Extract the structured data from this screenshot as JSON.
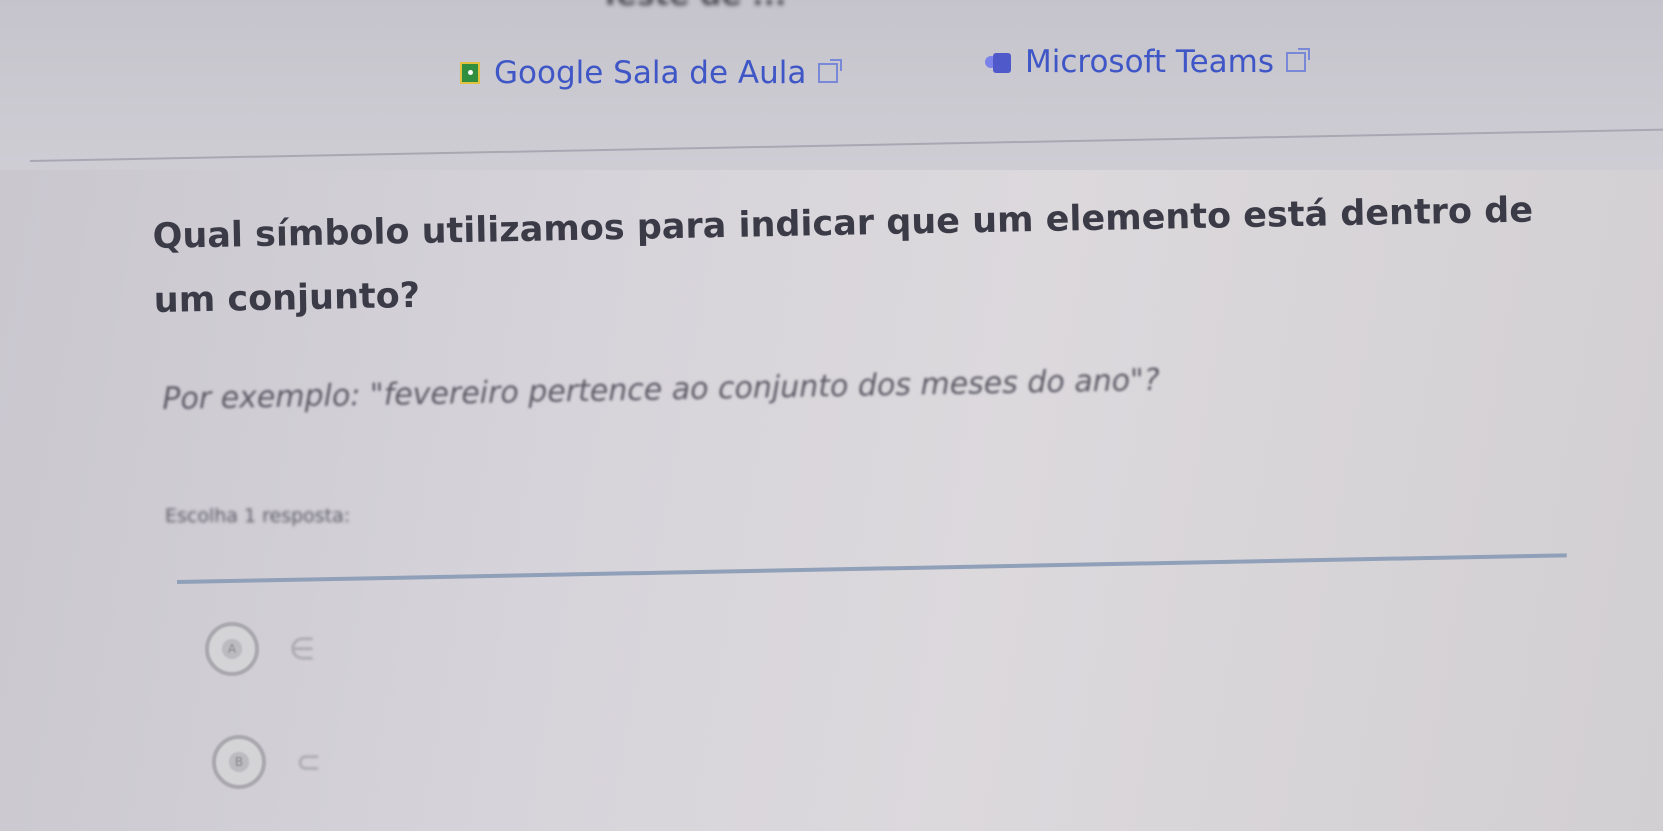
{
  "page": {
    "title_fragment": "Teste de ..."
  },
  "links": {
    "google_classroom": "Google Sala de Aula",
    "microsoft_teams": "Microsoft Teams"
  },
  "question": {
    "text": "Qual símbolo utilizamos para indicar que um elemento está dentro de um conjunto?",
    "example": "Por exemplo: \"fevereiro pertence ao conjunto dos meses do ano\"?",
    "instruction": "Escolha 1 resposta:"
  },
  "options": [
    {
      "letter": "A",
      "symbol": "∈"
    },
    {
      "letter": "B",
      "symbol": "⊂"
    }
  ],
  "colors": {
    "link": "#3f56c7",
    "text": "#3b3b47",
    "divider": "#8fa0b8"
  },
  "icons": {
    "classroom": "google-classroom-icon",
    "teams": "microsoft-teams-icon",
    "external": "external-link-icon"
  }
}
